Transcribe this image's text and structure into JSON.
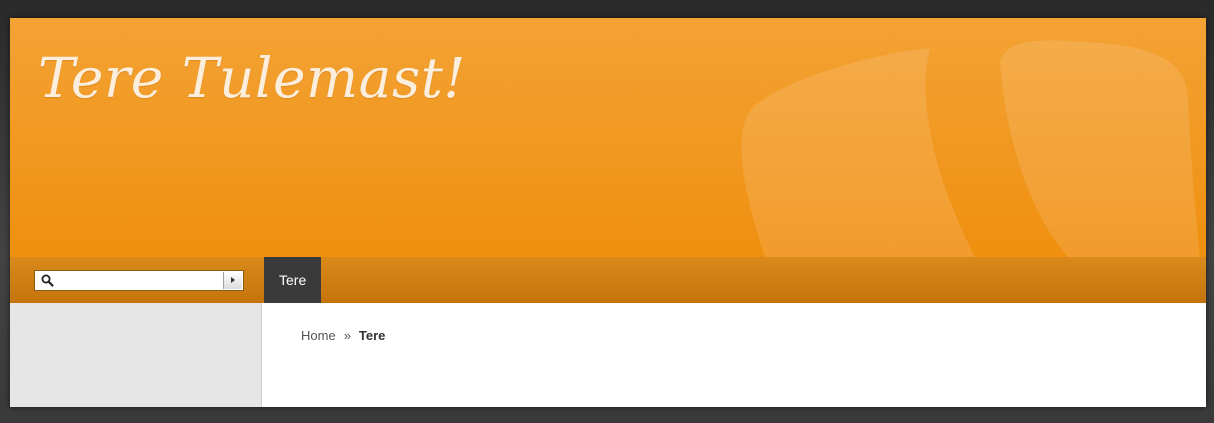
{
  "header": {
    "site_title": "Tere Tulemast!"
  },
  "search": {
    "value": "",
    "placeholder": ""
  },
  "nav": {
    "tabs": [
      {
        "label": "Tere",
        "active": true
      }
    ]
  },
  "breadcrumb": {
    "home": "Home",
    "separator": "»",
    "current": "Tere"
  },
  "colors": {
    "header_orange": "#f29a24",
    "navbar_orange": "#cd7f12",
    "active_tab": "#3a3a3a",
    "sidebar": "#e6e6e6",
    "page_background": "#3b3b3b"
  },
  "icons": {
    "search": "search-icon",
    "submit": "play-arrow-icon",
    "background_logo": "typo3-logo-watermark"
  }
}
